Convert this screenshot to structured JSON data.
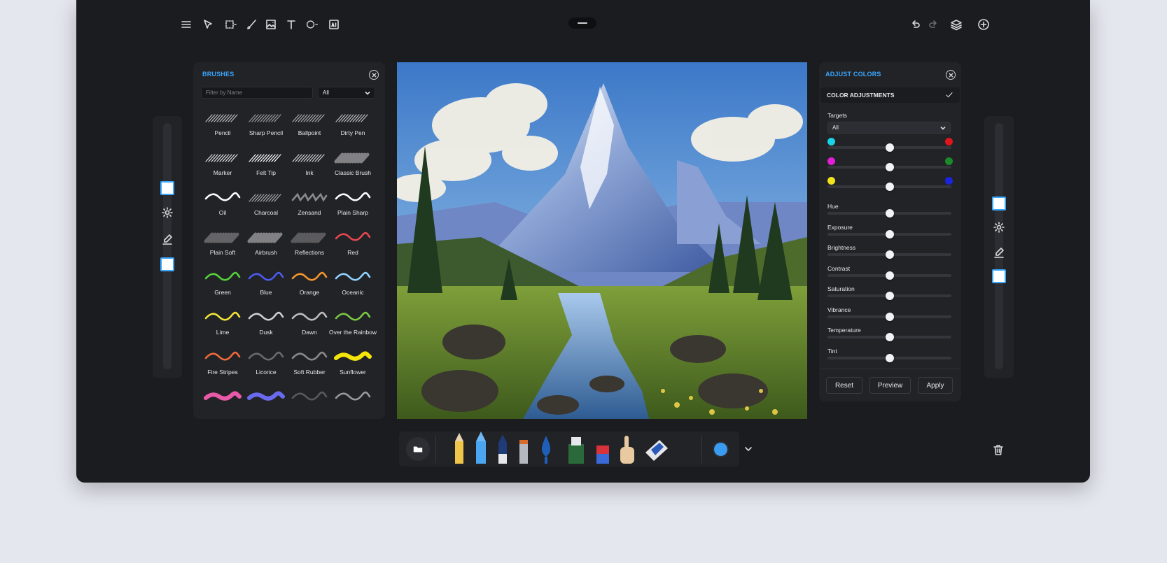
{
  "toolbar": {
    "tools": [
      {
        "name": "menu-icon",
        "active": false
      },
      {
        "name": "select-arrow-icon"
      },
      {
        "name": "marquee-select-icon"
      },
      {
        "name": "brush-icon"
      },
      {
        "name": "image-icon"
      },
      {
        "name": "text-icon"
      },
      {
        "name": "shape-icon"
      },
      {
        "name": "ai-icon"
      }
    ],
    "right": [
      "undo-icon",
      "redo-icon",
      "layers-icon",
      "add-icon"
    ]
  },
  "brushes_panel": {
    "title": "BRUSHES",
    "filter_placeholder": "Filter by Name",
    "category": "All",
    "brushes": [
      {
        "label": "Pencil",
        "color": "#bdbdbd",
        "style": "hatch"
      },
      {
        "label": "Sharp Pencil",
        "color": "#9c9c9c",
        "style": "hatch"
      },
      {
        "label": "Ballpoint",
        "color": "#aaaaaa",
        "style": "hatch"
      },
      {
        "label": "Dirty Pen",
        "color": "#bdbdbd",
        "style": "hatch"
      },
      {
        "label": "Marker",
        "color": "#e0e0e0",
        "style": "hatch"
      },
      {
        "label": "Felt Tip",
        "color": "#ffffff",
        "style": "hatch"
      },
      {
        "label": "Ink",
        "color": "#cfcfcf",
        "style": "hatch"
      },
      {
        "label": "Classic Brush",
        "color": "#d0d0d0",
        "style": "soft"
      },
      {
        "label": "Oil",
        "color": "#ffffff",
        "style": "wave"
      },
      {
        "label": "Charcoal",
        "color": "#a8a8a8",
        "style": "hatch"
      },
      {
        "label": "Zensand",
        "color": "#8a8a8a",
        "style": "zig"
      },
      {
        "label": "Plain Sharp",
        "color": "#ffffff",
        "style": "wave"
      },
      {
        "label": "Plain Soft",
        "color": "#9a9a9a",
        "style": "soft"
      },
      {
        "label": "Airbrush",
        "color": "#cfcfcf",
        "style": "soft"
      },
      {
        "label": "Reflections",
        "color": "#8a8a8a",
        "style": "soft"
      },
      {
        "label": "Red",
        "color": "#e4484e",
        "style": "wave"
      },
      {
        "label": "Green",
        "color": "#55d23a",
        "style": "wave"
      },
      {
        "label": "Blue",
        "color": "#4a5cf0",
        "style": "wave"
      },
      {
        "label": "Orange",
        "color": "#f5962a",
        "style": "wave"
      },
      {
        "label": "Oceanic",
        "color": "#8fd1ff",
        "style": "wave"
      },
      {
        "label": "Lime",
        "color": "#f3e43a",
        "style": "wave"
      },
      {
        "label": "Dusk",
        "color": "#cfcfcf",
        "style": "wave"
      },
      {
        "label": "Dawn",
        "color": "#bdbdbd",
        "style": "wave"
      },
      {
        "label": "Over the Rainbow",
        "color": "#7ac943",
        "style": "wave"
      },
      {
        "label": "Fire Stripes",
        "color": "#f06a3a",
        "style": "wave"
      },
      {
        "label": "Licorice",
        "color": "#6a6a6a",
        "style": "wave"
      },
      {
        "label": "Soft Rubber",
        "color": "#8a8a8a",
        "style": "wave"
      },
      {
        "label": "Sunflower",
        "color": "#f5e60a",
        "style": "fat"
      },
      {
        "label": "",
        "color": "#e85aa8",
        "style": "fat"
      },
      {
        "label": "",
        "color": "#6a6af0",
        "style": "fat"
      },
      {
        "label": "",
        "color": "#5a5a5a",
        "style": "wave"
      },
      {
        "label": "",
        "color": "#9a9a9a",
        "style": "wave"
      }
    ]
  },
  "adjust_panel": {
    "title": "ADJUST COLORS",
    "section": "COLOR ADJUSTMENTS",
    "targets_label": "Targets",
    "targets_value": "All",
    "color_pairs": [
      {
        "left": "#19d3e6",
        "right": "#e0141b",
        "value": 0.5
      },
      {
        "left": "#e01fd6",
        "right": "#1a8a2a",
        "value": 0.5
      },
      {
        "left": "#f2e21a",
        "right": "#1a24e0",
        "value": 0.5
      }
    ],
    "sliders": [
      {
        "label": "Hue",
        "value": 0.5
      },
      {
        "label": "Exposure",
        "value": 0.5
      },
      {
        "label": "Brightness",
        "value": 0.5
      },
      {
        "label": "Contrast",
        "value": 0.5
      },
      {
        "label": "Saturation",
        "value": 0.5
      },
      {
        "label": "Vibrance",
        "value": 0.5
      },
      {
        "label": "Temperature",
        "value": 0.5
      },
      {
        "label": "Tint",
        "value": 0.5
      }
    ],
    "buttons": {
      "reset": "Reset",
      "preview": "Preview",
      "apply": "Apply"
    }
  },
  "bottom_tools": [
    "folder-icon",
    "pencil-yellow",
    "pencil-blue",
    "pen-navy",
    "pen-grey",
    "ink-drop",
    "glue-bottle",
    "eraser",
    "hand-finger",
    "paint-tube"
  ],
  "current_color": "#3a9bf0",
  "accent": "#3aa7ff"
}
